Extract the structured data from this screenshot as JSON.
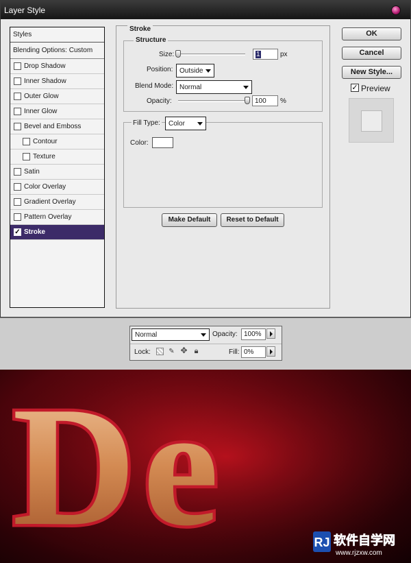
{
  "dialog": {
    "title": "Layer Style",
    "styles_header": "Styles",
    "blending_options": "Blending Options: Custom",
    "style_items": [
      {
        "label": "Drop Shadow",
        "checked": false,
        "level": 0
      },
      {
        "label": "Inner Shadow",
        "checked": false,
        "level": 0
      },
      {
        "label": "Outer Glow",
        "checked": false,
        "level": 0
      },
      {
        "label": "Inner Glow",
        "checked": false,
        "level": 0
      },
      {
        "label": "Bevel and Emboss",
        "checked": false,
        "level": 0
      },
      {
        "label": "Contour",
        "checked": false,
        "level": 1
      },
      {
        "label": "Texture",
        "checked": false,
        "level": 1
      },
      {
        "label": "Satin",
        "checked": false,
        "level": 0
      },
      {
        "label": "Color Overlay",
        "checked": false,
        "level": 0
      },
      {
        "label": "Gradient Overlay",
        "checked": false,
        "level": 0
      },
      {
        "label": "Pattern Overlay",
        "checked": false,
        "level": 0
      },
      {
        "label": "Stroke",
        "checked": true,
        "level": 0,
        "selected": true
      }
    ],
    "stroke": {
      "group_title": "Stroke",
      "structure_title": "Structure",
      "size_label": "Size:",
      "size_value": "1",
      "size_unit": "px",
      "position_label": "Position:",
      "position_value": "Outside",
      "blend_mode_label": "Blend Mode:",
      "blend_mode_value": "Normal",
      "opacity_label": "Opacity:",
      "opacity_value": "100",
      "opacity_unit": "%",
      "fill_type_label": "Fill Type:",
      "fill_type_value": "Color",
      "color_label": "Color:",
      "color_value": "#ffffff",
      "make_default": "Make Default",
      "reset_default": "Reset to Default",
      "size_slider_fraction": 0.0,
      "opacity_slider_fraction": 1.0
    },
    "buttons": {
      "ok": "OK",
      "cancel": "Cancel",
      "new_style": "New Style..."
    },
    "preview": {
      "label": "Preview",
      "checked": true
    }
  },
  "layers": {
    "blend_mode": "Normal",
    "opacity_label": "Opacity:",
    "opacity_value": "100%",
    "lock_label": "Lock:",
    "fill_label": "Fill:",
    "fill_value": "0%",
    "lock_icons": [
      "lock-transparent-icon",
      "lock-image-icon",
      "lock-position-icon",
      "lock-all-icon"
    ]
  },
  "artwork": {
    "text": "De",
    "colors": {
      "background": "#6d0710",
      "stroke": "#c21a2a",
      "letter": "#d89a63"
    }
  },
  "watermark": {
    "logo": "RJ",
    "cn_text": "软件自学网",
    "url": "www.rjzxw.com"
  }
}
